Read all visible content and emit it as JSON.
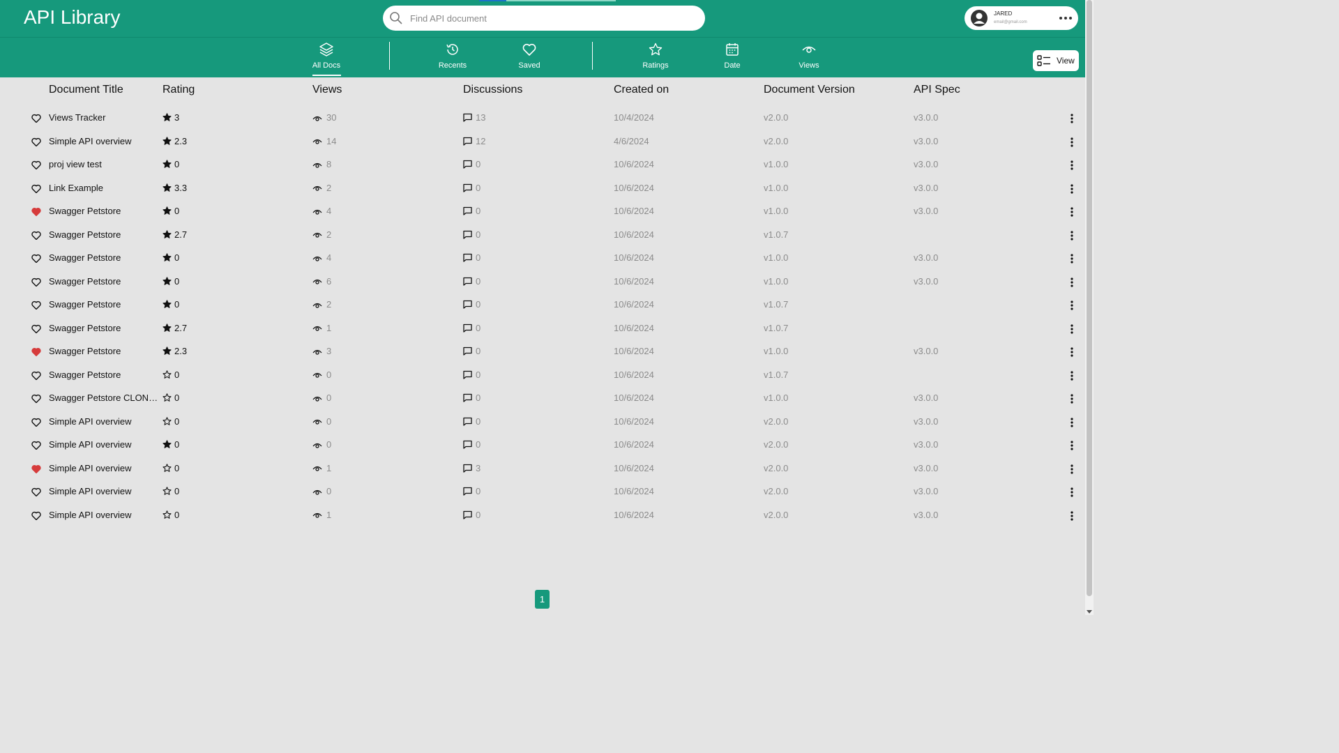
{
  "app": {
    "title": "API Library"
  },
  "search": {
    "placeholder": "Find API document"
  },
  "user": {
    "name": "JARED",
    "email": "email@gmail.com"
  },
  "loading_progress": 0.2,
  "nav": {
    "all_docs": "All Docs",
    "recents": "Recents",
    "saved": "Saved",
    "ratings": "Ratings",
    "date": "Date",
    "views": "Views",
    "active": "all_docs"
  },
  "view_button": "View",
  "columns": {
    "title": "Document Title",
    "rating": "Rating",
    "views": "Views",
    "discussions": "Discussions",
    "created": "Created on",
    "version": "Document Version",
    "spec": "API Spec"
  },
  "rows": [
    {
      "title": "Views Tracker",
      "saved": false,
      "rating": "3",
      "rated": true,
      "views": "30",
      "discussions": "13",
      "created": "10/4/2024",
      "version": "v2.0.0",
      "spec": "v3.0.0"
    },
    {
      "title": "Simple API overview",
      "saved": false,
      "rating": "2.3",
      "rated": true,
      "views": "14",
      "discussions": "12",
      "created": "4/6/2024",
      "version": "v2.0.0",
      "spec": "v3.0.0"
    },
    {
      "title": "proj view test",
      "saved": false,
      "rating": "0",
      "rated": true,
      "views": "8",
      "discussions": "0",
      "created": "10/6/2024",
      "version": "v1.0.0",
      "spec": "v3.0.0"
    },
    {
      "title": "Link Example",
      "saved": false,
      "rating": "3.3",
      "rated": true,
      "views": "2",
      "discussions": "0",
      "created": "10/6/2024",
      "version": "v1.0.0",
      "spec": "v3.0.0"
    },
    {
      "title": "Swagger Petstore",
      "saved": true,
      "rating": "0",
      "rated": true,
      "views": "4",
      "discussions": "0",
      "created": "10/6/2024",
      "version": "v1.0.0",
      "spec": "v3.0.0"
    },
    {
      "title": "Swagger Petstore",
      "saved": false,
      "rating": "2.7",
      "rated": true,
      "views": "2",
      "discussions": "0",
      "created": "10/6/2024",
      "version": "v1.0.7",
      "spec": ""
    },
    {
      "title": "Swagger Petstore",
      "saved": false,
      "rating": "0",
      "rated": true,
      "views": "4",
      "discussions": "0",
      "created": "10/6/2024",
      "version": "v1.0.0",
      "spec": "v3.0.0"
    },
    {
      "title": "Swagger Petstore",
      "saved": false,
      "rating": "0",
      "rated": true,
      "views": "6",
      "discussions": "0",
      "created": "10/6/2024",
      "version": "v1.0.0",
      "spec": "v3.0.0"
    },
    {
      "title": "Swagger Petstore",
      "saved": false,
      "rating": "0",
      "rated": true,
      "views": "2",
      "discussions": "0",
      "created": "10/6/2024",
      "version": "v1.0.7",
      "spec": ""
    },
    {
      "title": "Swagger Petstore",
      "saved": false,
      "rating": "2.7",
      "rated": true,
      "views": "1",
      "discussions": "0",
      "created": "10/6/2024",
      "version": "v1.0.7",
      "spec": ""
    },
    {
      "title": "Swagger Petstore",
      "saved": true,
      "rating": "2.3",
      "rated": true,
      "views": "3",
      "discussions": "0",
      "created": "10/6/2024",
      "version": "v1.0.0",
      "spec": "v3.0.0"
    },
    {
      "title": "Swagger Petstore",
      "saved": false,
      "rating": "0",
      "rated": false,
      "views": "0",
      "discussions": "0",
      "created": "10/6/2024",
      "version": "v1.0.7",
      "spec": ""
    },
    {
      "title": "Swagger Petstore CLONE OF ...",
      "saved": false,
      "rating": "0",
      "rated": false,
      "views": "0",
      "discussions": "0",
      "created": "10/6/2024",
      "version": "v1.0.0",
      "spec": "v3.0.0"
    },
    {
      "title": "Simple API overview",
      "saved": false,
      "rating": "0",
      "rated": false,
      "views": "0",
      "discussions": "0",
      "created": "10/6/2024",
      "version": "v2.0.0",
      "spec": "v3.0.0"
    },
    {
      "title": "Simple API overview",
      "saved": false,
      "rating": "0",
      "rated": true,
      "views": "0",
      "discussions": "0",
      "created": "10/6/2024",
      "version": "v2.0.0",
      "spec": "v3.0.0"
    },
    {
      "title": "Simple API overview",
      "saved": true,
      "rating": "0",
      "rated": false,
      "views": "1",
      "discussions": "3",
      "created": "10/6/2024",
      "version": "v2.0.0",
      "spec": "v3.0.0"
    },
    {
      "title": "Simple API overview",
      "saved": false,
      "rating": "0",
      "rated": false,
      "views": "0",
      "discussions": "0",
      "created": "10/6/2024",
      "version": "v2.0.0",
      "spec": "v3.0.0"
    },
    {
      "title": "Simple API overview",
      "saved": false,
      "rating": "0",
      "rated": false,
      "views": "1",
      "discussions": "0",
      "created": "10/6/2024",
      "version": "v2.0.0",
      "spec": "v3.0.0"
    }
  ],
  "pagination": {
    "current": "1"
  },
  "colors": {
    "brand": "#16997c",
    "saved_heart": "#d63b3b"
  }
}
